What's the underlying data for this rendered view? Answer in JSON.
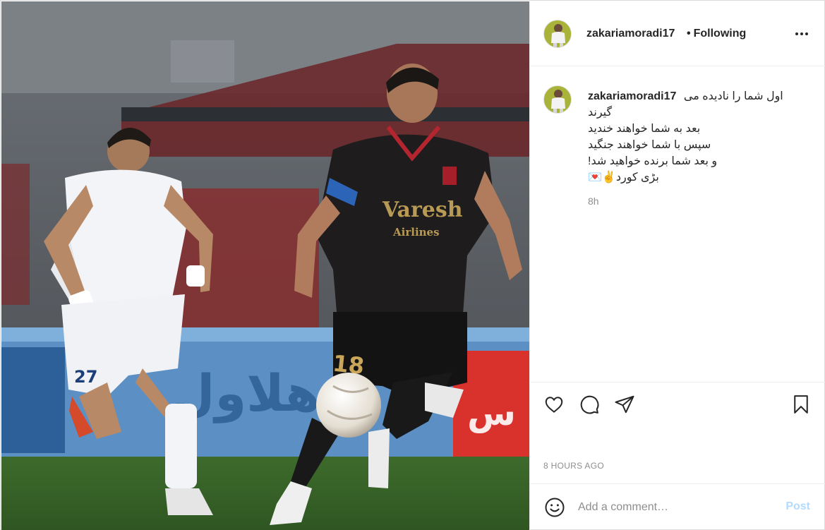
{
  "post": {
    "username": "zakariamoradi17",
    "follow_separator": "•",
    "follow_status": "Following",
    "caption_lines": [
      "اول شما را نادیده می",
      "گیرند",
      "بعد به شما خواهند خندید",
      "سپس با شما خواهند جنگید",
      "و بعد شما برنده خواهید شد!",
      "بڑی کورد✌️💌"
    ],
    "caption_age": "8h",
    "timestamp": "8 HOURS AGO"
  },
  "photo": {
    "jersey_sponsor": "Varesh",
    "jersey_sponsor_sub": "Airlines",
    "player_number_dark": "18",
    "player_number_white": "27"
  },
  "comment_box": {
    "placeholder": "Add a comment…",
    "post_label": "Post"
  },
  "icons": {
    "more": "more-options-icon",
    "like": "heart-icon",
    "comment": "comment-icon",
    "share": "share-icon",
    "save": "bookmark-icon",
    "emoji": "emoji-icon"
  },
  "colors": {
    "text": "#262626",
    "muted": "#8e8e8e",
    "post_button_disabled": "#b3dbff",
    "border": "#efefef"
  }
}
